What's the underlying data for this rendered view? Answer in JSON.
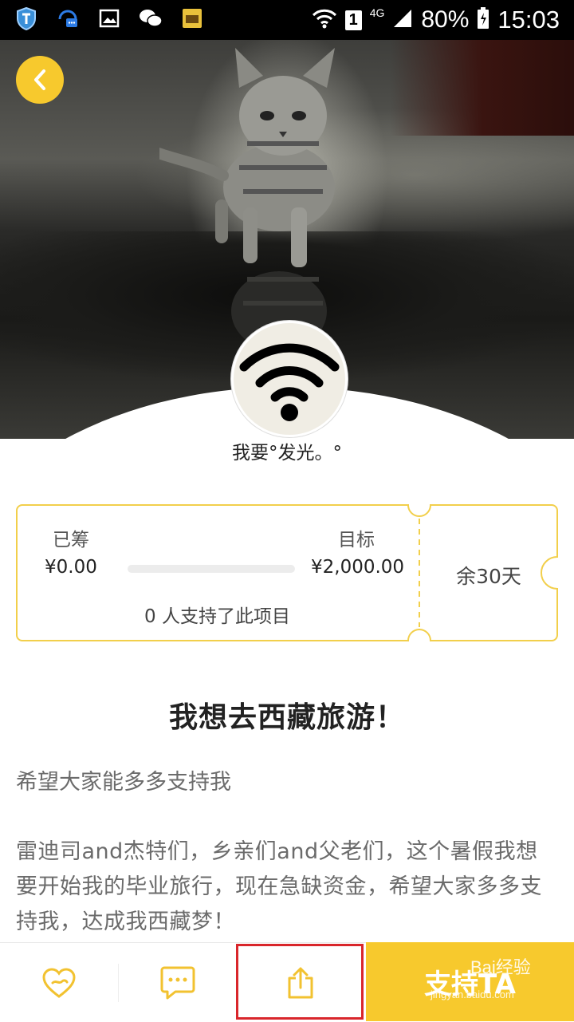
{
  "status_bar": {
    "network": "4G",
    "sim": "1",
    "battery": "80%",
    "time": "15:03"
  },
  "hero": {
    "back_icon": "chevron-left-icon",
    "avatar_icon": "wifi-icon"
  },
  "project": {
    "owner_name": "我要°发光。°",
    "raised_label": "已筹",
    "raised_value": "¥0.00",
    "goal_label": "目标",
    "goal_value": "¥2,000.00",
    "progress_fraction": 0,
    "supporters_text": "0 人支持了此项目",
    "days_left": "余30天",
    "title": "我想去西藏旅游！",
    "summary": "希望大家能多多支持我",
    "description": "雷迪司and杰特们，乡亲们and父老们，这个暑假我想要开始我的毕业旅行，现在急缺资金，希望大家多多支持我，达成我西藏梦！"
  },
  "bottom_bar": {
    "like_icon": "heart-icon",
    "comment_icon": "comment-icon",
    "share_icon": "share-icon",
    "support_label": "支持TA",
    "watermark": "Bai经验",
    "watermark_url": "jingyan.baidu.com"
  },
  "colors": {
    "accent": "#f7c92d",
    "highlight": "#d9262b"
  }
}
